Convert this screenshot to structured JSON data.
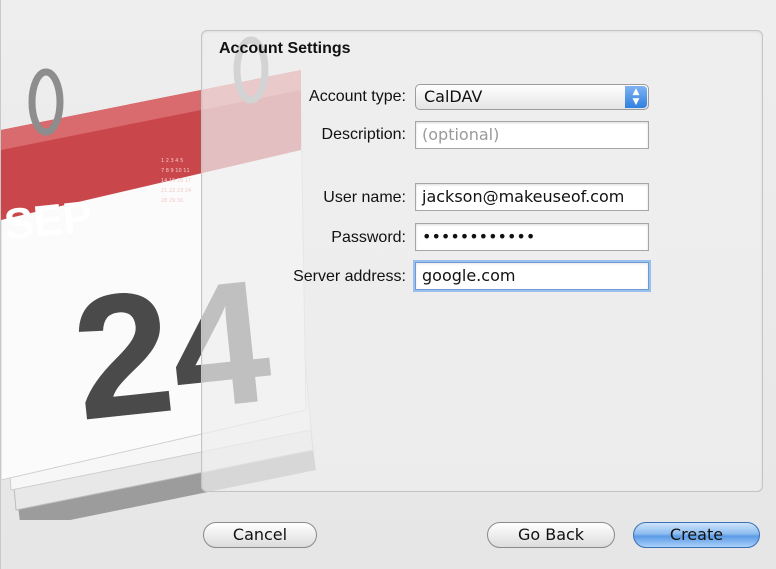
{
  "calendar_icon": {
    "month": "SEP",
    "day": "24"
  },
  "panel": {
    "title": "Account Settings"
  },
  "form": {
    "account_type_label": "Account type:",
    "account_type_value": "CalDAV",
    "description_label": "Description:",
    "description_placeholder": "(optional)",
    "username_label": "User name:",
    "username_value": "jackson@makeuseof.com",
    "password_label": "Password:",
    "password_value": "••••••••••••",
    "server_label": "Server address:",
    "server_value": "google.com"
  },
  "buttons": {
    "cancel": "Cancel",
    "go_back": "Go Back",
    "create": "Create"
  },
  "colors": {
    "calendar_red": "#c9474b",
    "accent_blue": "#5c9be6"
  }
}
